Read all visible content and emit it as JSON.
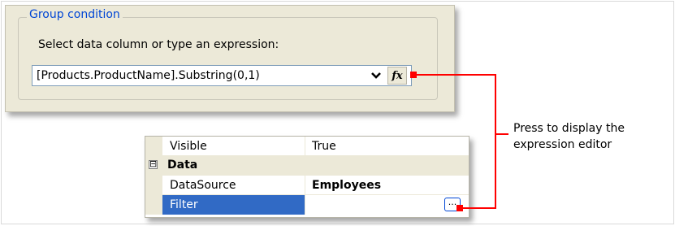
{
  "group_condition": {
    "legend": "Group condition",
    "prompt": "Select data column or type an expression:",
    "expression_value": "[Products.ProductName].Substring(0,1)",
    "dropdown_icon": "chevron-down-icon",
    "fx_icon": "fx-icon",
    "fx_label": "fx"
  },
  "property_grid": {
    "rows": [
      {
        "name": "Visible",
        "value": "True"
      },
      {
        "category": "Data",
        "expander": "⊟"
      },
      {
        "name": "DataSource",
        "value": "Employees"
      },
      {
        "name": "Filter",
        "value": "",
        "button": "..."
      }
    ]
  },
  "callout": {
    "line1": "Press to display the",
    "line2": "expression editor",
    "color": "#ff0000"
  },
  "colors": {
    "panel_bg": "#ece9d8",
    "legend_text": "#0046d5",
    "selection": "#316ac5"
  }
}
